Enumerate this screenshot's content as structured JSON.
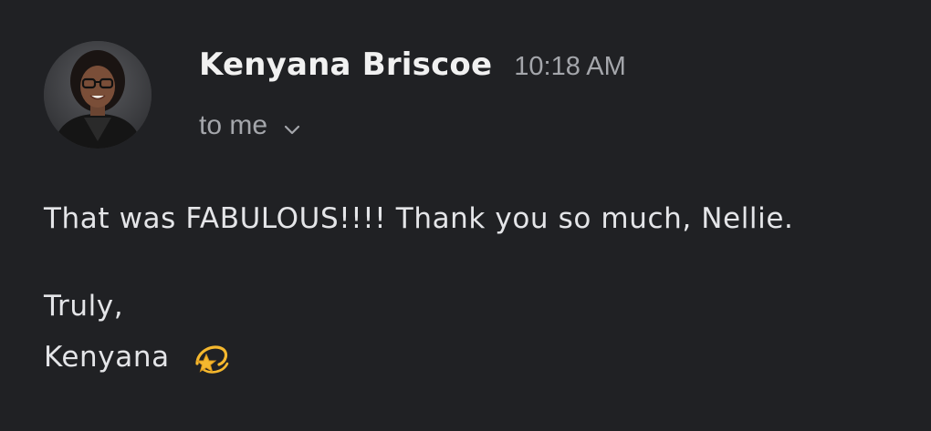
{
  "sender": {
    "name": "Kenyana Briscoe",
    "time": "10:18 AM"
  },
  "recipient": {
    "label": "to me",
    "toggle_icon": "chevron-down-icon"
  },
  "avatar": {
    "icon": "sender-photo"
  },
  "body": {
    "line1": "That was FABULOUS!!!! Thank you so much, Nellie.",
    "closing": "Truly,",
    "signature": "Kenyana",
    "signature_emoji": "dizzy-star-icon"
  },
  "colors": {
    "background": "#202124",
    "primary_text": "#f1f1f1",
    "secondary_text": "#a4a6ab",
    "emoji_gold": "#f5b82e"
  }
}
